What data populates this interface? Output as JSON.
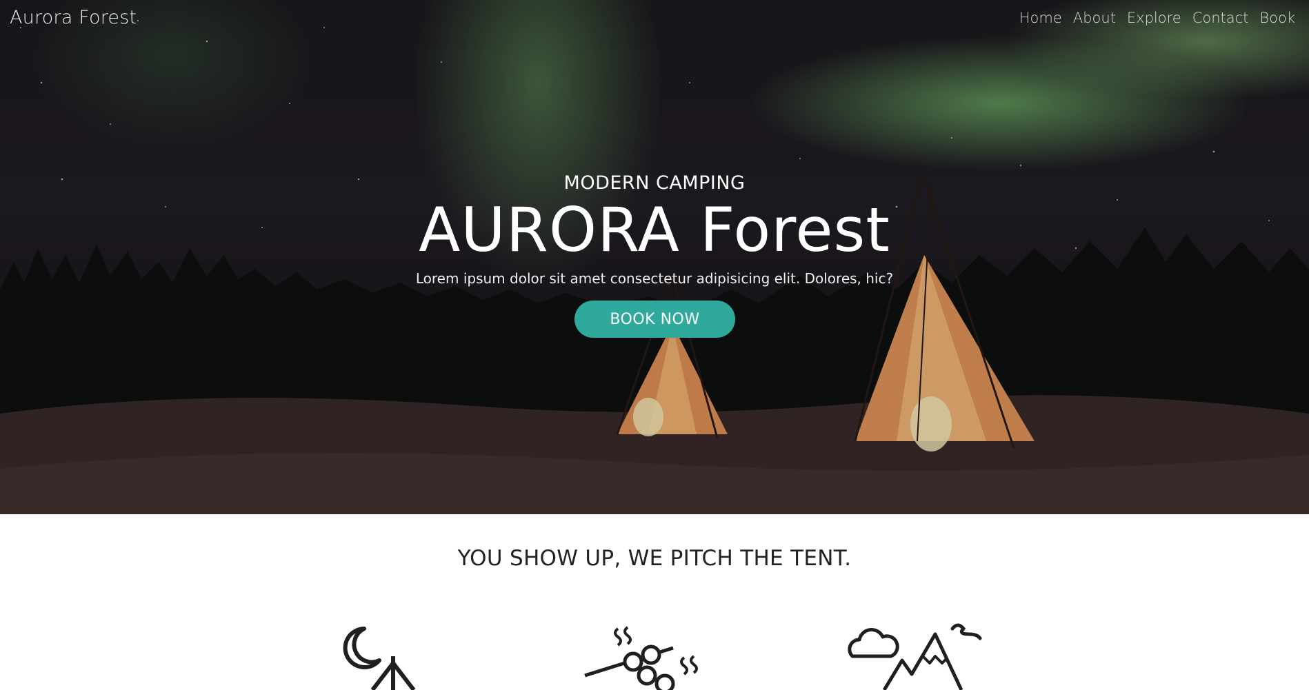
{
  "nav": {
    "logo": "Aurora Forest",
    "links": [
      "Home",
      "About",
      "Explore",
      "Contact",
      "Book"
    ]
  },
  "hero": {
    "eyebrow": "MODERN CAMPING",
    "title": "AURORA Forest",
    "subtitle": "Lorem ipsum dolor sit amet consectetur adipisicing elit. Dolores, hic?",
    "button_label": "BOOK NOW"
  },
  "section": {
    "title": "YOU SHOW UP, WE PITCH THE TENT."
  },
  "features": {
    "icons": [
      "moon-tent-icon",
      "marshmallow-skewer-icon",
      "cloud-mountain-icon"
    ]
  },
  "colors": {
    "accent": "#2fa99c",
    "aurora": "#78be6e",
    "text_dark": "#222222"
  }
}
